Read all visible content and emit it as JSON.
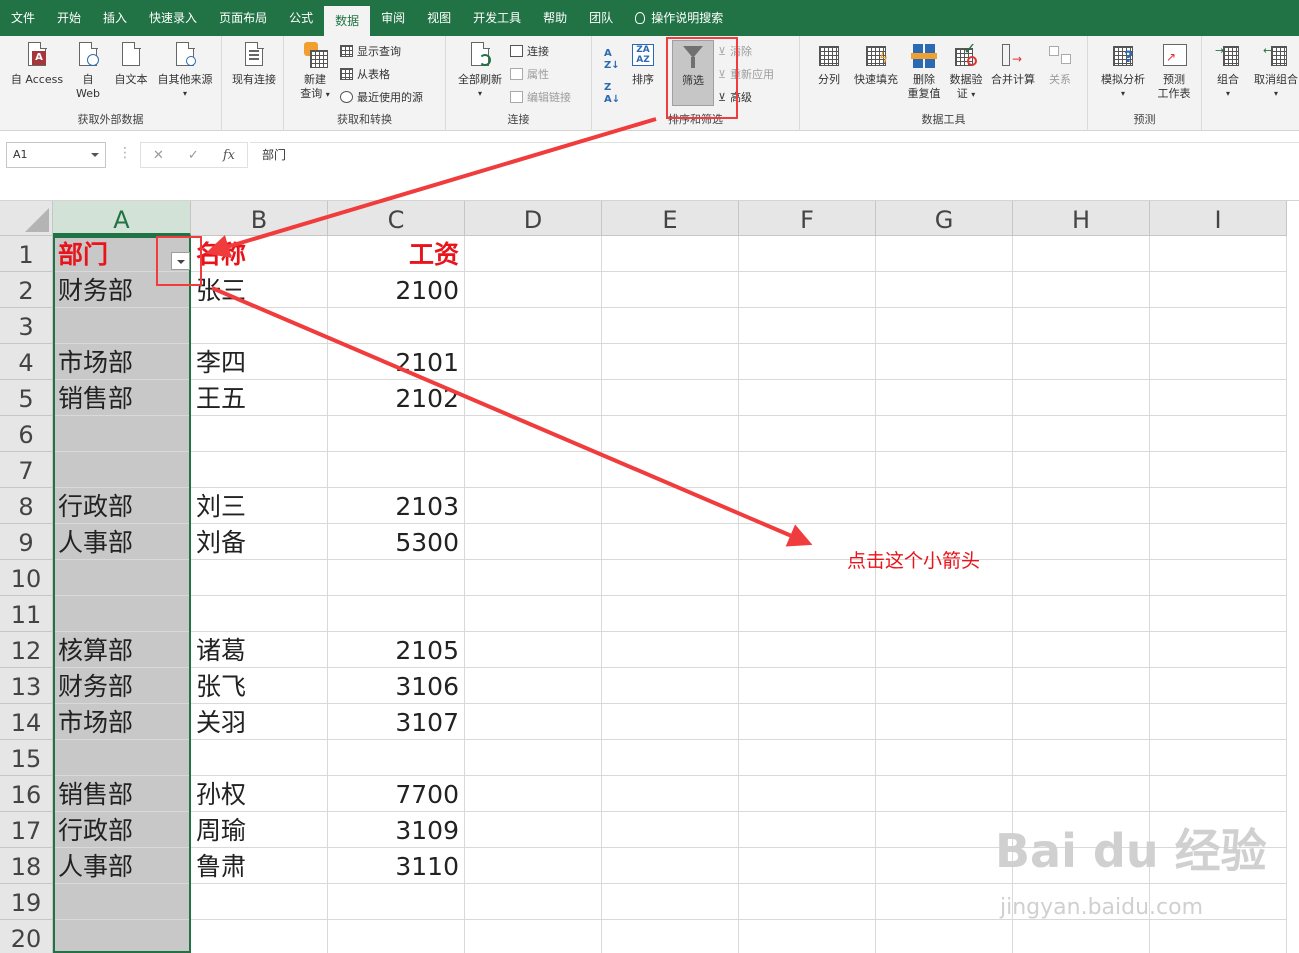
{
  "menu": {
    "tabs": [
      "文件",
      "开始",
      "插入",
      "快速录入",
      "页面布局",
      "公式",
      "数据",
      "审阅",
      "视图",
      "开发工具",
      "帮助",
      "团队"
    ],
    "active_tab": "数据",
    "search_label": "操作说明搜索"
  },
  "ribbon": {
    "external": {
      "label": "获取外部数据",
      "access": "自 Access",
      "web_line1": "自",
      "web_line2": "Web",
      "text": "自文本",
      "other": "自其他来源",
      "existing": "现有连接"
    },
    "transform": {
      "label": "获取和转换",
      "new_query_line1": "新建",
      "new_query_line2": "查询",
      "show_queries": "显示查询",
      "from_table": "从表格",
      "recent_sources": "最近使用的源"
    },
    "connections": {
      "label": "连接",
      "refresh_all": "全部刷新",
      "connections": "连接",
      "properties": "属性",
      "edit_links": "编辑链接"
    },
    "sort_filter": {
      "label": "排序和筛选",
      "sort": "排序",
      "filter": "筛选",
      "clear": "清除",
      "reapply": "重新应用",
      "advanced": "高级"
    },
    "data_tools": {
      "label": "数据工具",
      "split": "分列",
      "flash_fill": "快速填充",
      "remove_dup_line1": "删除",
      "remove_dup_line2": "重复值",
      "validation_line1": "数据验",
      "validation_line2": "证",
      "consolidate": "合并计算",
      "relations": "关系"
    },
    "forecast": {
      "label": "预测",
      "what_if": "模拟分析",
      "sheet_line1": "预测",
      "sheet_line2": "工作表"
    },
    "outline": {
      "group": "组合",
      "ungroup": "取消组合"
    }
  },
  "formula_bar": {
    "name_box": "A1",
    "formula": "部门"
  },
  "sheet": {
    "columns": [
      "A",
      "B",
      "C",
      "D",
      "E",
      "F",
      "G",
      "H",
      "I"
    ],
    "rows": [
      [
        "部门",
        "名称",
        "工资"
      ],
      [
        "财务部",
        "张三",
        "2100"
      ],
      [
        "",
        "",
        ""
      ],
      [
        "市场部",
        "李四",
        "2101"
      ],
      [
        "销售部",
        "王五",
        "2102"
      ],
      [
        "",
        "",
        ""
      ],
      [
        "",
        "",
        ""
      ],
      [
        "行政部",
        "刘三",
        "2103"
      ],
      [
        "人事部",
        "刘备",
        "5300"
      ],
      [
        "",
        "",
        ""
      ],
      [
        "",
        "",
        ""
      ],
      [
        "核算部",
        "诸葛",
        "2105"
      ],
      [
        "财务部",
        "张飞",
        "3106"
      ],
      [
        "市场部",
        "关羽",
        "3107"
      ],
      [
        "",
        "",
        ""
      ],
      [
        "销售部",
        "孙权",
        "7700"
      ],
      [
        "行政部",
        "周瑜",
        "3109"
      ],
      [
        "人事部",
        "鲁肃",
        "3110"
      ],
      [
        "",
        "",
        ""
      ],
      [
        "",
        "",
        ""
      ]
    ]
  },
  "annotation": {
    "note": "点击这个小箭头",
    "color": "#f03c3c"
  },
  "watermark": {
    "main": "Bai du 经验",
    "sub": "jingyan.baidu.com"
  }
}
